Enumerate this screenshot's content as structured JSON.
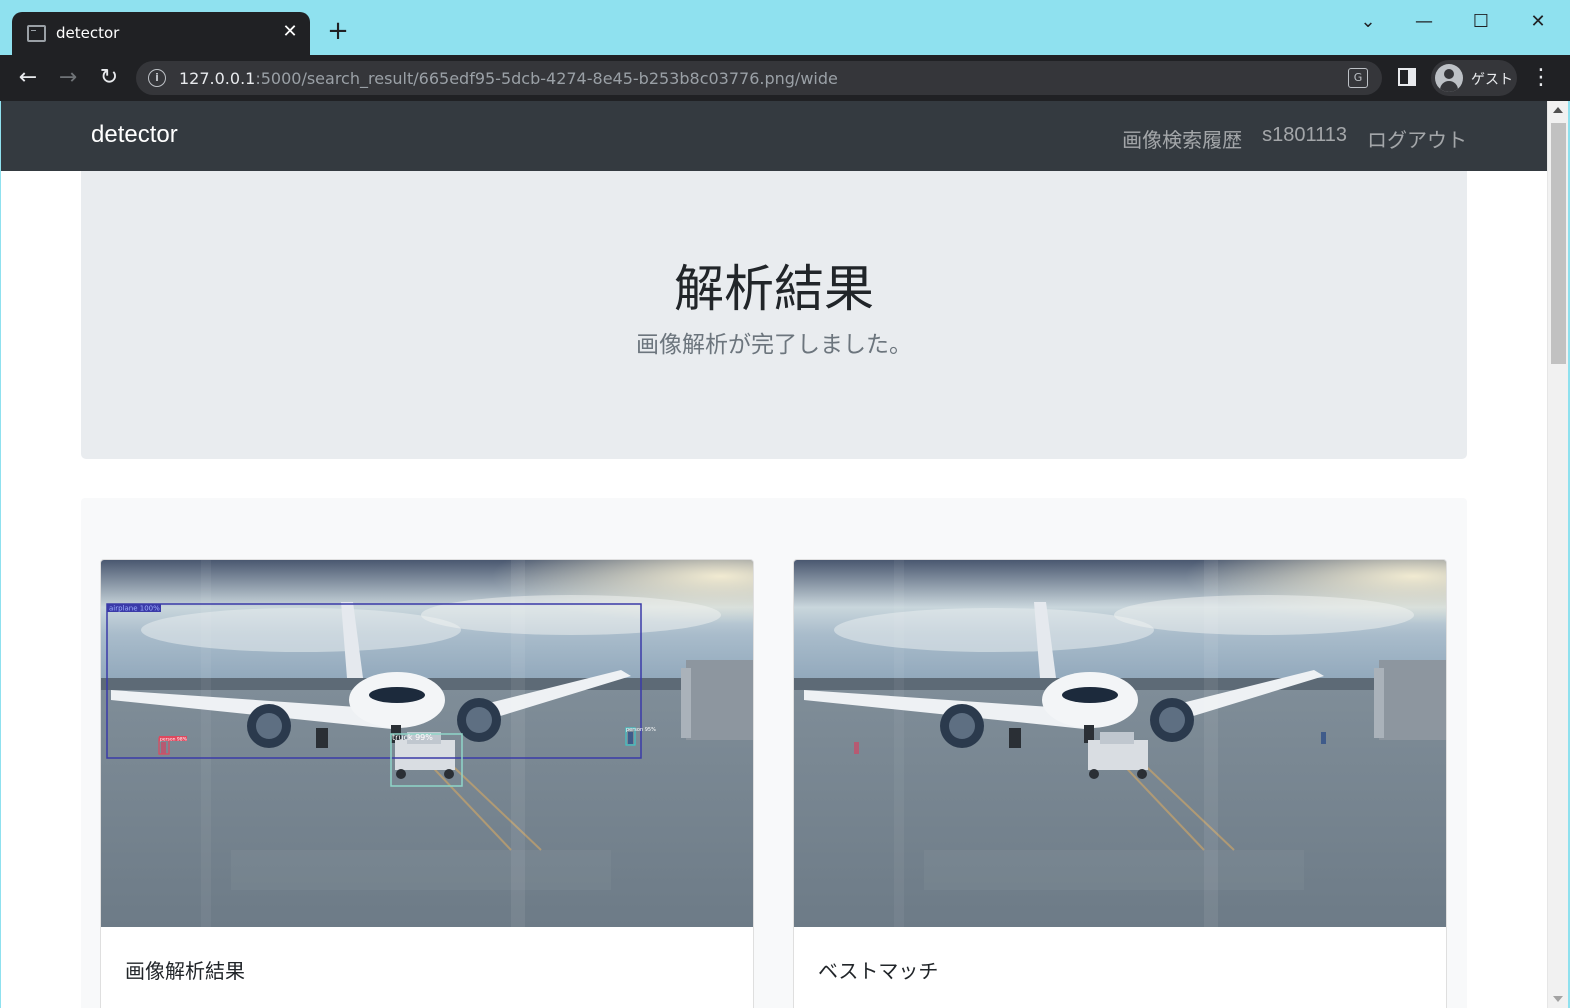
{
  "browser": {
    "tab_title": "detector",
    "url_host": "127.0.0.1",
    "url_path": ":5000/search_result/665edf95-5dcb-4274-8e45-b253b8c03776.png/wide",
    "profile_name": "ゲスト"
  },
  "navbar": {
    "brand": "detector",
    "links": [
      "画像検索履歴",
      "s1801113",
      "ログアウト"
    ]
  },
  "hero": {
    "title": "解析結果",
    "subtitle": "画像解析が完了しました。"
  },
  "cards": [
    {
      "title": "画像解析結果",
      "detections": [
        {
          "label": "airplane 100%",
          "color": "#3a3aa8"
        },
        {
          "label": "truck 99%",
          "color": "#8fd6c9"
        },
        {
          "label": "person 98%",
          "color": "#e0485e"
        },
        {
          "label": "person 95%",
          "color": "#3fc7c7"
        }
      ]
    },
    {
      "title": "ベストマッチ"
    }
  ],
  "colors": {
    "navbar_bg": "#343a40",
    "hero_bg": "#e9ecef",
    "tabstrip_bg": "#8fe1ef"
  }
}
